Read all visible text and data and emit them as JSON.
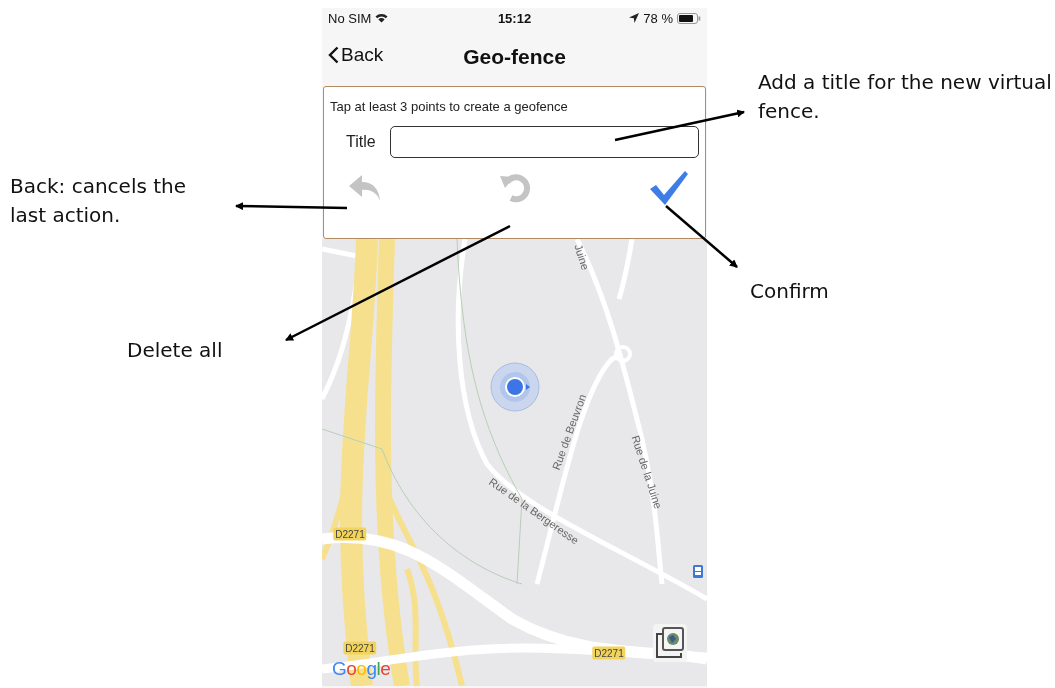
{
  "status_bar": {
    "carrier": "No SIM",
    "time": "15:12",
    "battery": "78 %"
  },
  "nav": {
    "back": "Back",
    "title": "Geo-fence"
  },
  "panel": {
    "hint": "Tap at least  3 points to create a geofence",
    "title_label": "Title",
    "actions": [
      {
        "kind": "undo",
        "disabled": true
      },
      {
        "kind": "reset",
        "disabled": true
      },
      {
        "kind": "confirm",
        "disabled": false
      }
    ]
  },
  "map": {
    "labels": [
      {
        "kind": "street",
        "text": "Juine"
      },
      {
        "kind": "street",
        "text": "Rue de Beuvron"
      },
      {
        "kind": "street",
        "text": "Rue de la Juine"
      },
      {
        "kind": "street",
        "text": "Rue de la Bergeresse"
      },
      {
        "kind": "road",
        "text": "D2271"
      },
      {
        "kind": "road",
        "text": "D2271"
      },
      {
        "kind": "road",
        "text": "D2271"
      }
    ],
    "logo": "Google"
  },
  "annotations": [
    {
      "kind": "title",
      "text": "Add a title for the new virtual fence."
    },
    {
      "kind": "back",
      "text": "Back: cancels the last action."
    },
    {
      "kind": "confirm",
      "text": "Confirm"
    },
    {
      "kind": "delete",
      "text": "Delete all"
    }
  ]
}
